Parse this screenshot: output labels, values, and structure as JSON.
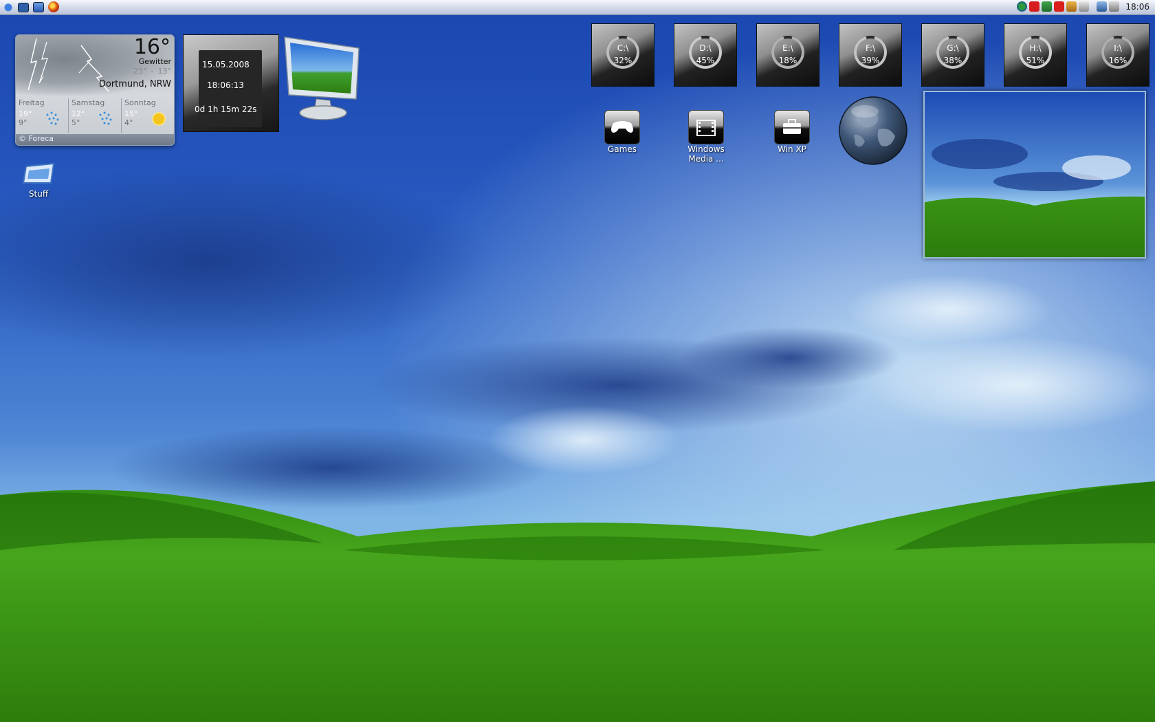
{
  "menubar": {
    "left_icons": [
      "apple-icon",
      "desktop-icon",
      "window-icon",
      "firefox-icon"
    ],
    "tray_icons": [
      "network-icon",
      "antivirus-icon",
      "update-icon",
      "acrobat-icon",
      "settings-icon",
      "printer-icon",
      "display-icon",
      "volume-icon"
    ],
    "clock": "18:06"
  },
  "weather": {
    "temp": "16°",
    "condition": "Gewitter",
    "high": "23°",
    "sep": "-",
    "low": "13°",
    "city": "Dortmund, NRW",
    "forecast": [
      {
        "day": "Freitag",
        "hi": "19°",
        "lo": "9°",
        "icon": "rain-icon"
      },
      {
        "day": "Samstag",
        "hi": "12°",
        "lo": "5°",
        "icon": "rain-icon"
      },
      {
        "day": "Sonntag",
        "hi": "15°",
        "lo": "4°",
        "icon": "sun-icon"
      }
    ],
    "credit": "© Foreca"
  },
  "clock_widget": {
    "date": "15.05.2008",
    "time": "18:06:13",
    "uptime": "0d 1h 15m 22s"
  },
  "drives": [
    {
      "label": "C:\\",
      "percent": "32%",
      "fill": 0.32
    },
    {
      "label": "D:\\",
      "percent": "45%",
      "fill": 0.45
    },
    {
      "label": "E:\\",
      "percent": "18%",
      "fill": 0.18
    },
    {
      "label": "F:\\",
      "percent": "39%",
      "fill": 0.39
    },
    {
      "label": "G:\\",
      "percent": "38%",
      "fill": 0.38
    },
    {
      "label": "H:\\",
      "percent": "51%",
      "fill": 0.51
    },
    {
      "label": "I:\\",
      "percent": "16%",
      "fill": 0.16
    }
  ],
  "desktop_icons": {
    "stuff": "Stuff",
    "games": "Games",
    "media_line1": "Windows",
    "media_line2": "Media ...",
    "winxp": "Win XP"
  }
}
